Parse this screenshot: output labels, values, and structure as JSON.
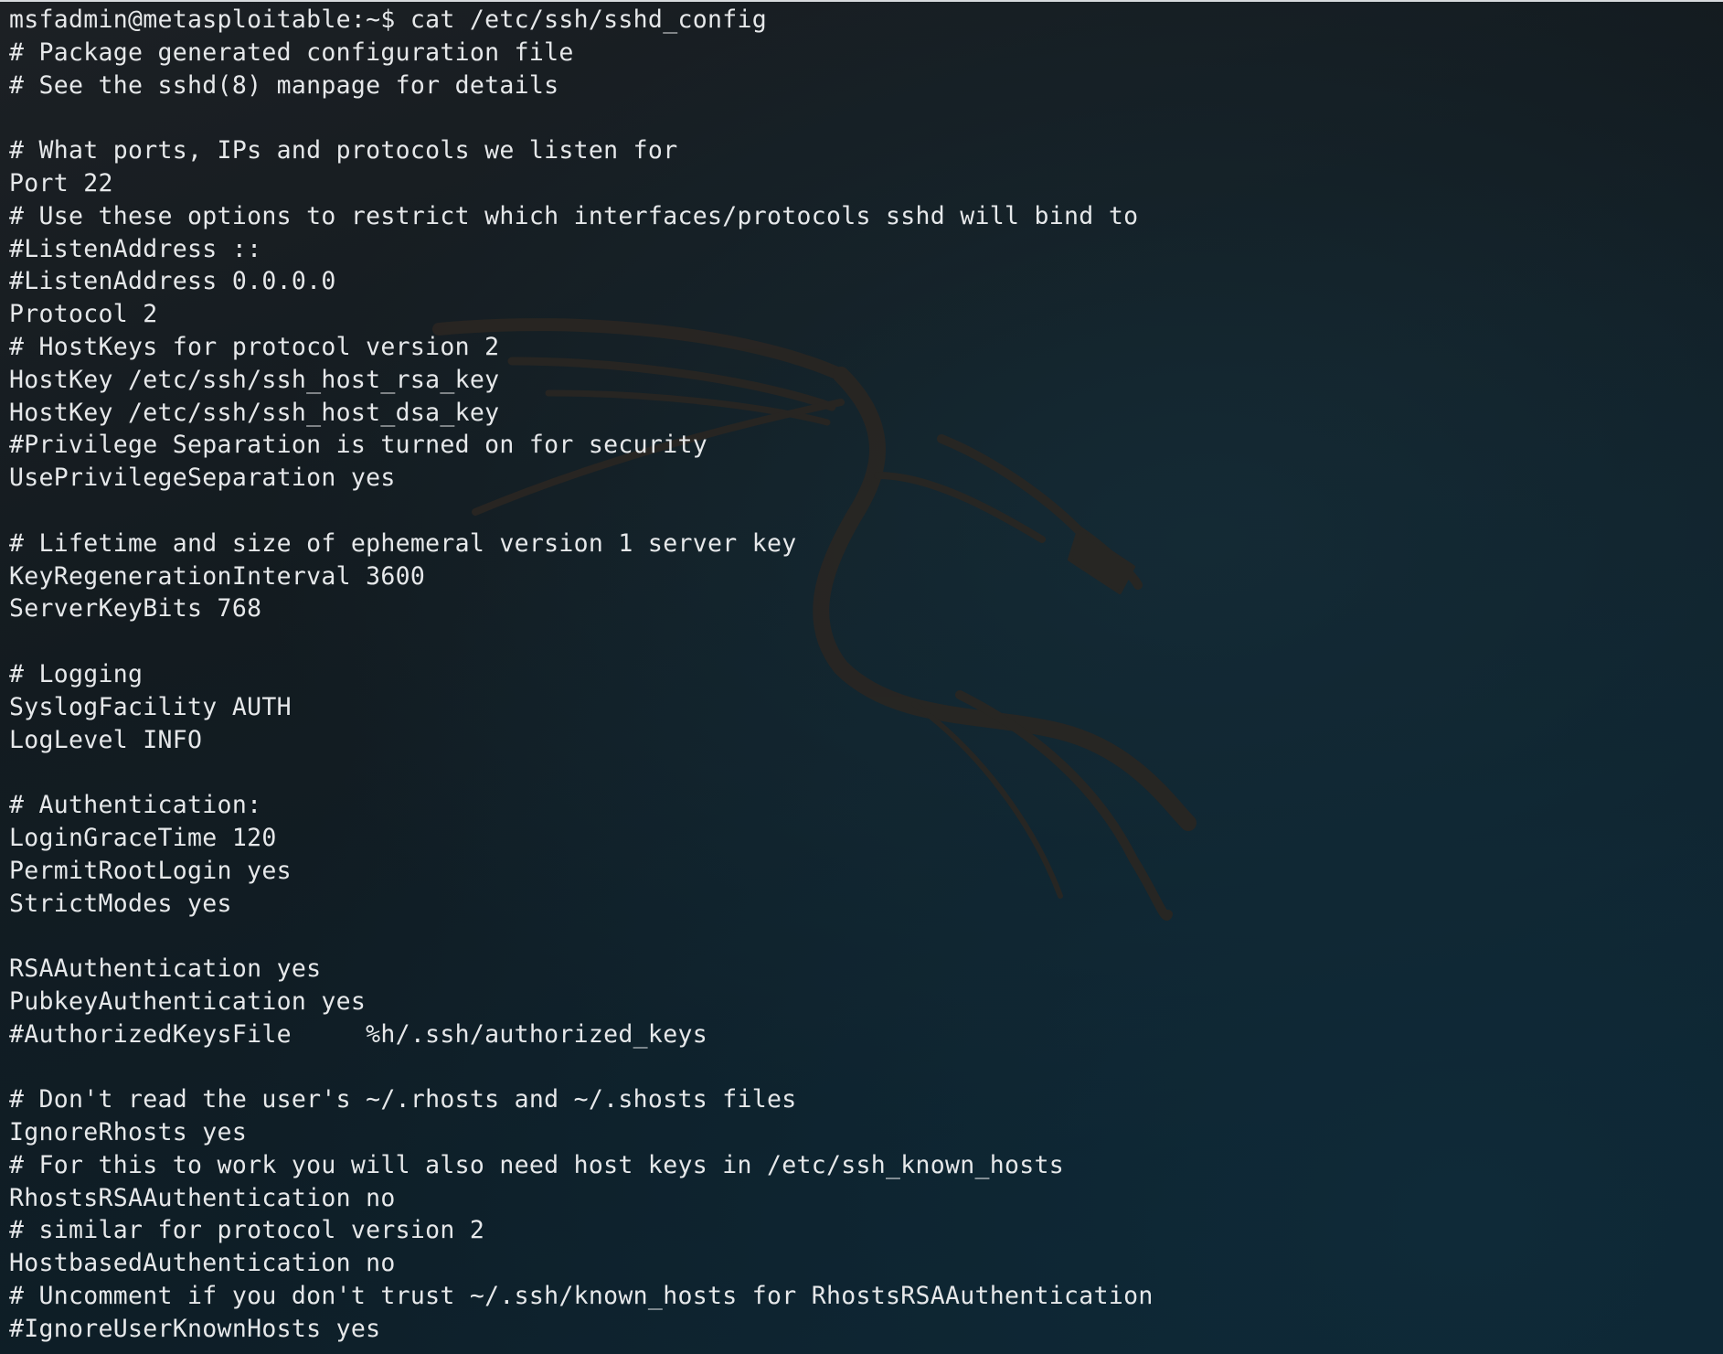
{
  "terminal": {
    "prompt": "msfadmin@metasploitable:~$",
    "command": "cat /etc/ssh/sshd_config",
    "lines": [
      "msfadmin@metasploitable:~$ cat /etc/ssh/sshd_config",
      "# Package generated configuration file",
      "# See the sshd(8) manpage for details",
      "",
      "# What ports, IPs and protocols we listen for",
      "Port 22",
      "# Use these options to restrict which interfaces/protocols sshd will bind to",
      "#ListenAddress ::",
      "#ListenAddress 0.0.0.0",
      "Protocol 2",
      "# HostKeys for protocol version 2",
      "HostKey /etc/ssh/ssh_host_rsa_key",
      "HostKey /etc/ssh/ssh_host_dsa_key",
      "#Privilege Separation is turned on for security",
      "UsePrivilegeSeparation yes",
      "",
      "# Lifetime and size of ephemeral version 1 server key",
      "KeyRegenerationInterval 3600",
      "ServerKeyBits 768",
      "",
      "# Logging",
      "SyslogFacility AUTH",
      "LogLevel INFO",
      "",
      "# Authentication:",
      "LoginGraceTime 120",
      "PermitRootLogin yes",
      "StrictModes yes",
      "",
      "RSAAuthentication yes",
      "PubkeyAuthentication yes",
      "#AuthorizedKeysFile     %h/.ssh/authorized_keys",
      "",
      "# Don't read the user's ~/.rhosts and ~/.shosts files",
      "IgnoreRhosts yes",
      "# For this to work you will also need host keys in /etc/ssh_known_hosts",
      "RhostsRSAAuthentication no",
      "# similar for protocol version 2",
      "HostbasedAuthentication no",
      "# Uncomment if you don't trust ~/.ssh/known_hosts for RhostsRSAAuthentication",
      "#IgnoreUserKnownHosts yes"
    ]
  },
  "wallpaper": {
    "logo_icon": "kali-dragon-icon"
  },
  "colors": {
    "text": "#e6e8ea",
    "background": "#131b20",
    "background_accent": "#0c2230",
    "logo": "#2a2622"
  }
}
